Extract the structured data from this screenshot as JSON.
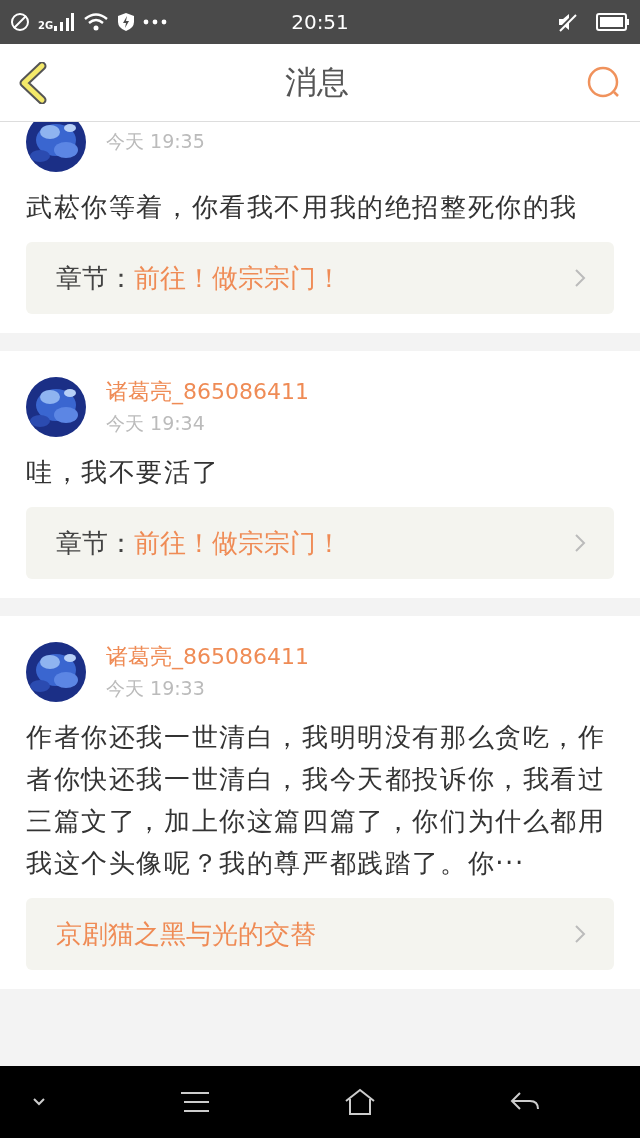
{
  "status_bar": {
    "network": "2G",
    "time": "20:51"
  },
  "header": {
    "title": "消息"
  },
  "messages": [
    {
      "time": "今天 19:35",
      "text": "武菘你等着，你看我不用我的绝招整死你的我",
      "link": {
        "kind": "chapter",
        "label": "章节：",
        "title": "前往！做宗宗门！"
      }
    },
    {
      "author": "诸葛亮_865086411",
      "time": "今天 19:34",
      "text": "哇，我不要活了",
      "link": {
        "kind": "chapter",
        "label": "章节：",
        "title": "前往！做宗宗门！"
      }
    },
    {
      "author": "诸葛亮_865086411",
      "time": "今天 19:33",
      "text": "作者你还我一世清白，我明明没有那么贪吃，作者你快还我一世清白，我今天都投诉你，我看过三篇文了，加上你这篇四篇了，你们为什么都用我这个头像呢？我的尊严都践踏了。你···",
      "link": {
        "kind": "book",
        "title": "京剧猫之黑与光的交替"
      }
    }
  ]
}
